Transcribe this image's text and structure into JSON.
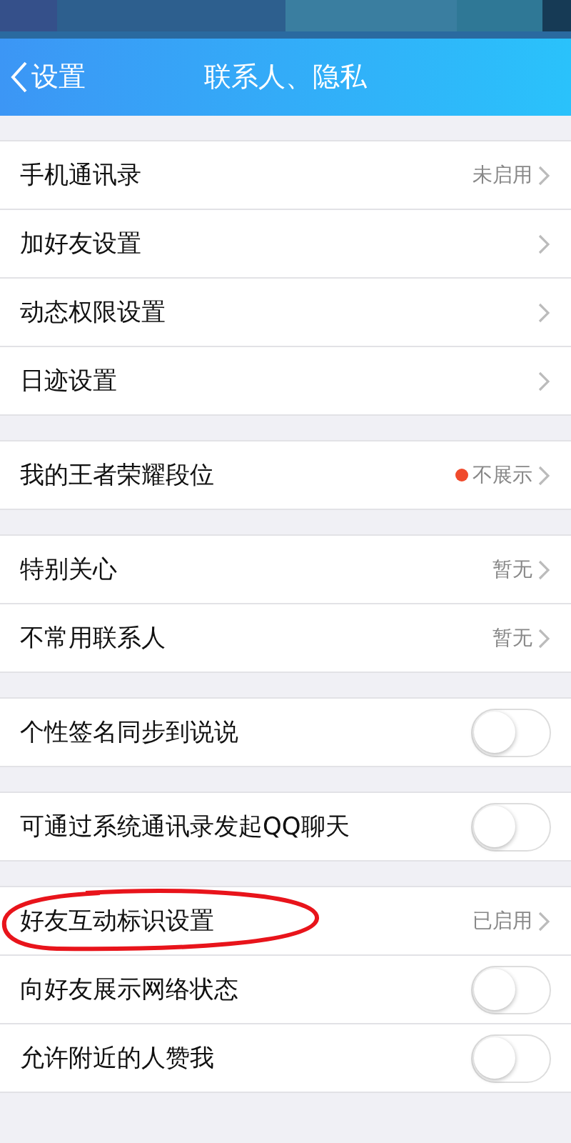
{
  "nav_bar": {
    "back_label": "设置",
    "title": "联系人、隐私"
  },
  "groups": [
    {
      "items": [
        {
          "kind": "link",
          "label": "手机通讯录",
          "value": "未启用"
        },
        {
          "kind": "link",
          "label": "加好友设置"
        },
        {
          "kind": "link",
          "label": "动态权限设置"
        },
        {
          "kind": "link",
          "label": "日迹设置"
        }
      ]
    },
    {
      "items": [
        {
          "kind": "link",
          "label": "我的王者荣耀段位",
          "value": "不展示",
          "color": "#f04a2c"
        }
      ]
    },
    {
      "items": [
        {
          "kind": "link",
          "label": "特别关心",
          "value": "暂无"
        },
        {
          "kind": "link",
          "label": "不常用联系人",
          "value": "暂无"
        }
      ]
    },
    {
      "items": [
        {
          "kind": "toggle",
          "label": "个性签名同步到说说",
          "on": false
        }
      ]
    },
    {
      "items": [
        {
          "kind": "toggle",
          "label": "可通过系统通讯录发起QQ聊天",
          "on": false
        }
      ]
    },
    {
      "items": [
        {
          "kind": "link",
          "label": "好友互动标识设置",
          "value": "已启用",
          "circled": true
        },
        {
          "kind": "toggle",
          "label": "向好友展示网络状态",
          "on": false
        },
        {
          "kind": "toggle",
          "label": "允许附近的人赞我",
          "on": false
        }
      ]
    }
  ]
}
